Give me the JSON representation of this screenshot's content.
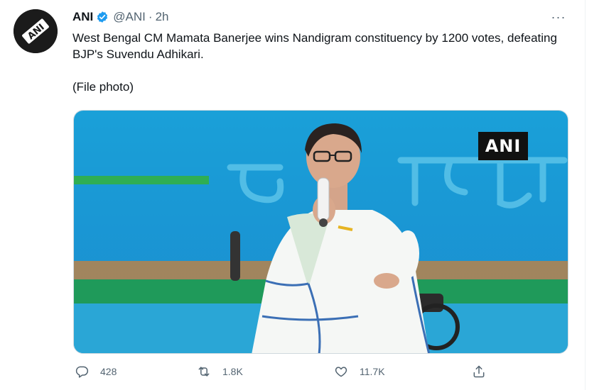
{
  "tweet": {
    "author_name": "ANI",
    "handle": "@ANI",
    "separator": "·",
    "time": "2h",
    "text_line1": "West Bengal CM Mamata Banerjee wins Nandigram constituency by 1200 votes, defeating BJP's Suvendu Adhikari.",
    "text_line2": "(File photo)",
    "more_label": "···",
    "media_watermark": "ANI",
    "avatar_logo_text": "ANI"
  },
  "actions": {
    "replies": "428",
    "retweets": "1.8K",
    "likes": "11.7K"
  },
  "icons": {
    "verified": "verified-badge-icon",
    "more": "more-icon",
    "reply": "reply-icon",
    "retweet": "retweet-icon",
    "like": "heart-icon",
    "share": "share-icon"
  },
  "colors": {
    "verified": "#1d9bf0",
    "secondary_text": "#536471",
    "primary_text": "#0f1419"
  }
}
